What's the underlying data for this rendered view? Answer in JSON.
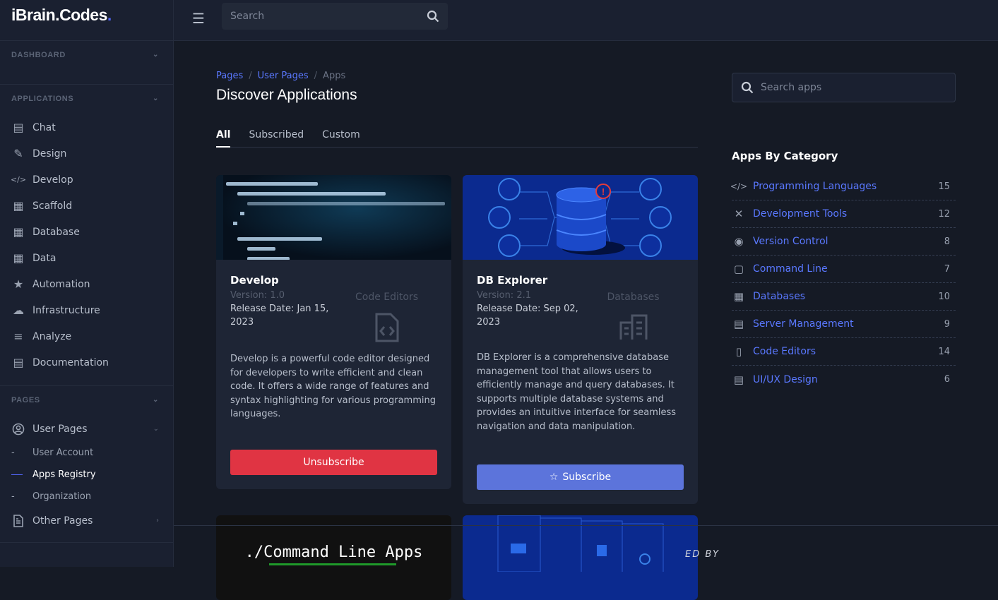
{
  "logo": {
    "text": "iBrain.Codes",
    "dot": "."
  },
  "sidebar": {
    "sections": [
      {
        "label": "DASHBOARD"
      },
      {
        "label": "APPLICATIONS"
      },
      {
        "label": "PAGES"
      }
    ],
    "apps": [
      {
        "label": "Chat",
        "icon": "chat-icon"
      },
      {
        "label": "Design",
        "icon": "design-icon"
      },
      {
        "label": "Develop",
        "icon": "code-icon"
      },
      {
        "label": "Scaffold",
        "icon": "scaffold-icon"
      },
      {
        "label": "Database",
        "icon": "database-icon"
      },
      {
        "label": "Data",
        "icon": "data-icon"
      },
      {
        "label": "Automation",
        "icon": "automation-icon"
      },
      {
        "label": "Infrastructure",
        "icon": "cloud-icon"
      },
      {
        "label": "Analyze",
        "icon": "sliders-icon"
      },
      {
        "label": "Documentation",
        "icon": "document-icon"
      }
    ],
    "pages": {
      "user_pages": "User Pages",
      "subs": [
        "User Account",
        "Apps Registry",
        "Organization"
      ],
      "active_sub": "Apps Registry",
      "other_pages": "Other Pages"
    }
  },
  "header": {
    "search_placeholder": "Search"
  },
  "breadcrumb": [
    "Pages",
    "User Pages",
    "Apps"
  ],
  "page_title": "Discover Applications",
  "tabs": [
    "All",
    "Subscribed",
    "Custom"
  ],
  "active_tab": "All",
  "cards": [
    {
      "title": "Develop",
      "version": "Version: 1.0",
      "release": "Release Date: Jan 15, 2023",
      "category": "Code Editors",
      "description": "Develop is a powerful code editor designed for developers to write efficient and clean code. It offers a wide range of features and syntax highlighting for various programming languages.",
      "button": "Unsubscribe"
    },
    {
      "title": "DB Explorer",
      "version": "Version: 2.1",
      "release": "Release Date: Sep 02, 2023",
      "category": "Databases",
      "description": "DB Explorer is a comprehensive database management tool that allows users to efficiently manage and query databases. It supports multiple database systems and provides an intuitive interface for seamless navigation and data manipulation.",
      "button": "Subscribe"
    },
    {
      "image_title": "./Command Line Apps"
    }
  ],
  "right": {
    "search_placeholder": "Search apps",
    "title": "Apps By Category",
    "categories": [
      {
        "name": "Programming Languages",
        "count": "15"
      },
      {
        "name": "Development Tools",
        "count": "12"
      },
      {
        "name": "Version Control",
        "count": "8"
      },
      {
        "name": "Command Line",
        "count": "7"
      },
      {
        "name": "Databases",
        "count": "10"
      },
      {
        "name": "Server Management",
        "count": "9"
      },
      {
        "name": "Code Editors",
        "count": "14"
      },
      {
        "name": "UI/UX Design",
        "count": "6"
      }
    ]
  },
  "footer": {
    "powered": "ED BY"
  },
  "colors": {
    "accent": "#5468ff",
    "danger": "#e03443",
    "primary_btn": "#5c74db",
    "bg": "#151a25",
    "panel": "#1a2030"
  }
}
